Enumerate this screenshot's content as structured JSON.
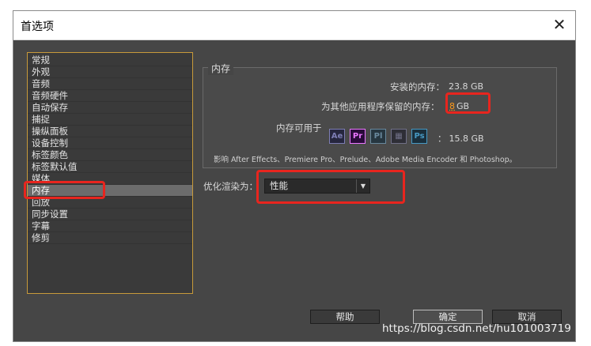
{
  "window": {
    "title": "首选项",
    "close_glyph": "✕"
  },
  "sidebar": {
    "items": [
      {
        "label": "常规"
      },
      {
        "label": "外观"
      },
      {
        "label": "音频"
      },
      {
        "label": "音频硬件"
      },
      {
        "label": "自动保存"
      },
      {
        "label": "捕捉"
      },
      {
        "label": "操纵面板"
      },
      {
        "label": "设备控制"
      },
      {
        "label": "标签颜色"
      },
      {
        "label": "标签默认值"
      },
      {
        "label": "媒体"
      },
      {
        "label": "内存"
      },
      {
        "label": "回放"
      },
      {
        "label": "同步设置"
      },
      {
        "label": "字幕"
      },
      {
        "label": "修剪"
      }
    ],
    "active_index": 11
  },
  "memory": {
    "group_title": "内存",
    "installed_label": "安装的内存：",
    "installed_value": "23.8 GB",
    "reserved_label": "为其他应用程序保留的内存：",
    "reserved_value": "8",
    "reserved_unit": "GB",
    "available_label": "内存可用于",
    "apps": [
      {
        "icon": "ae-icon",
        "label": "Ae"
      },
      {
        "icon": "pr-icon",
        "label": "Pr"
      },
      {
        "icon": "pl-icon",
        "label": "Pl"
      },
      {
        "icon": "media-encoder-icon",
        "label": "▦"
      },
      {
        "icon": "ps-icon",
        "label": "Ps"
      }
    ],
    "available_value": "：  15.8 GB",
    "note": "影响 After Effects、Premiere Pro、Prelude、Adobe Media Encoder 和 Photoshop。"
  },
  "render": {
    "label": "优化渲染为：",
    "selected": "性能",
    "arrow_glyph": "▼"
  },
  "buttons": {
    "help": "帮助",
    "ok": "确定",
    "cancel": "取消"
  },
  "watermark": "https://blog.csdn.net/hu101003719",
  "colors": {
    "highlight": "#e8251e",
    "reserved_value": "#ff9a1a",
    "sidebar_border": "#c89a3a"
  }
}
